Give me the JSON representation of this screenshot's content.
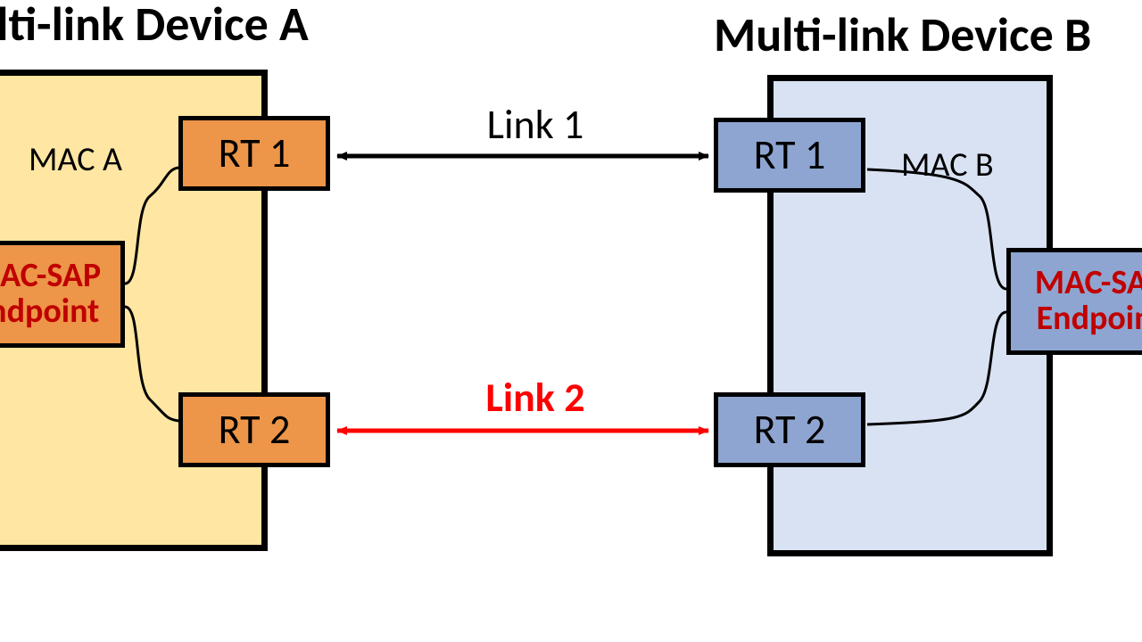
{
  "deviceA": {
    "title": "Multi-link Device A",
    "mac_label": "MAC A",
    "rt1": "RT 1",
    "rt2": "RT 2",
    "endpoint_l1": "MAC-SAP",
    "endpoint_l2": "Endpoint"
  },
  "deviceB": {
    "title": "Multi-link Device B",
    "mac_label": "MAC B",
    "rt1": "RT 1",
    "rt2": "RT 2",
    "endpoint_l1": "MAC-SAP",
    "endpoint_l2": "Endpoint"
  },
  "links": {
    "link1": "Link 1",
    "link2": "Link 2"
  }
}
